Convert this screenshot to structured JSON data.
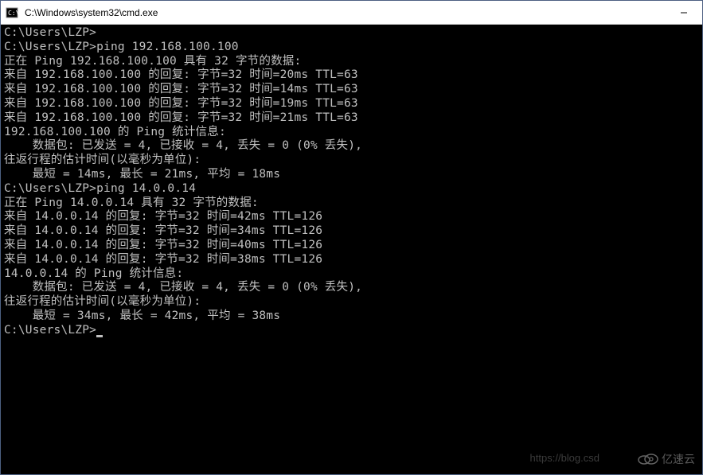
{
  "window": {
    "title": "C:\\Windows\\system32\\cmd.exe"
  },
  "terminal": {
    "lines": [
      "C:\\Users\\LZP>",
      "C:\\Users\\LZP>ping 192.168.100.100",
      "",
      "正在 Ping 192.168.100.100 具有 32 字节的数据:",
      "来自 192.168.100.100 的回复: 字节=32 时间=20ms TTL=63",
      "来自 192.168.100.100 的回复: 字节=32 时间=14ms TTL=63",
      "来自 192.168.100.100 的回复: 字节=32 时间=19ms TTL=63",
      "来自 192.168.100.100 的回复: 字节=32 时间=21ms TTL=63",
      "",
      "192.168.100.100 的 Ping 统计信息:",
      "    数据包: 已发送 = 4, 已接收 = 4, 丢失 = 0 (0% 丢失),",
      "往返行程的估计时间(以毫秒为单位):",
      "    最短 = 14ms, 最长 = 21ms, 平均 = 18ms",
      "",
      "C:\\Users\\LZP>ping 14.0.0.14",
      "",
      "正在 Ping 14.0.0.14 具有 32 字节的数据:",
      "来自 14.0.0.14 的回复: 字节=32 时间=42ms TTL=126",
      "来自 14.0.0.14 的回复: 字节=32 时间=34ms TTL=126",
      "来自 14.0.0.14 的回复: 字节=32 时间=40ms TTL=126",
      "来自 14.0.0.14 的回复: 字节=32 时间=38ms TTL=126",
      "",
      "14.0.0.14 的 Ping 统计信息:",
      "    数据包: 已发送 = 4, 已接收 = 4, 丢失 = 0 (0% 丢失),",
      "往返行程的估计时间(以毫秒为单位):",
      "    最短 = 34ms, 最长 = 42ms, 平均 = 38ms",
      "",
      "C:\\Users\\LZP>"
    ],
    "prompt_cursor": true
  },
  "watermark": {
    "center": "https://blog.csd",
    "right": "亿速云"
  }
}
